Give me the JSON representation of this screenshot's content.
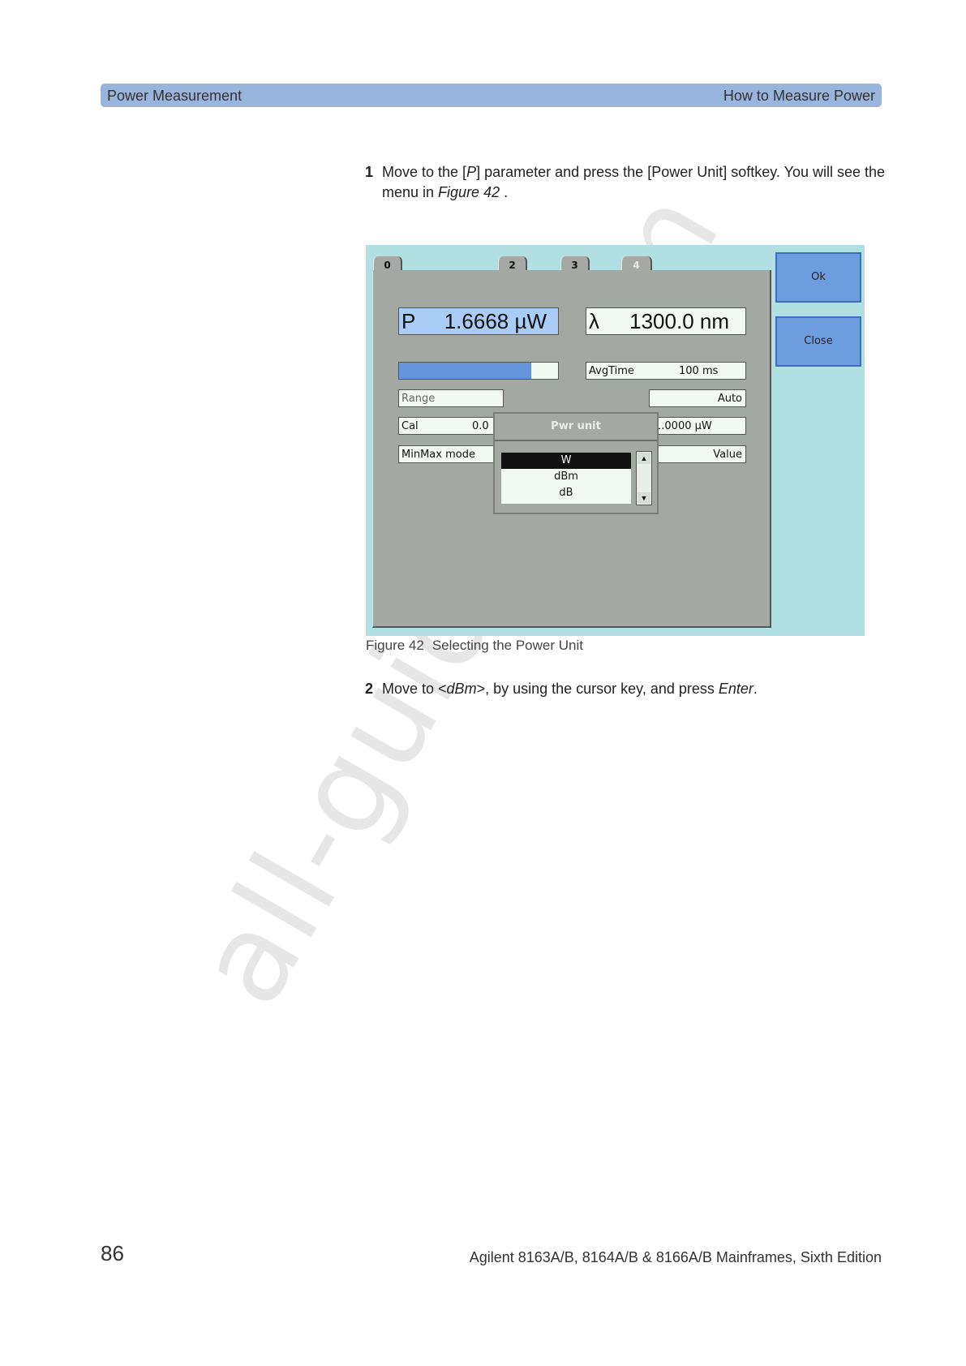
{
  "watermark": "all-guides.com",
  "header": {
    "left": "Power Measurement",
    "right": "How to Measure Power"
  },
  "step1": {
    "num": "1",
    "parts": [
      "Move to the [",
      "P",
      "] parameter and press the [Power Unit] softkey. You will see the menu in ",
      "Figure 42",
      "  ."
    ]
  },
  "figure": {
    "tabs": [
      "0",
      "2",
      "3",
      "4"
    ],
    "power_label": "P",
    "power_value": "1.6668 µW",
    "wavelength_label": "λ",
    "wavelength_value": "1300.0 nm",
    "bar_fill": 0.83,
    "avgtime_label": "AvgTime",
    "avgtime_value": "100  ms",
    "range_label": "Range",
    "range_value": "Auto",
    "cal_label": "Cal",
    "cal_value": "0.0",
    "ref_value": "1.0000  µW",
    "minmax_label": "MinMax mode",
    "minmax_value": "Value",
    "ok_label": "Ok",
    "close_label": "Close",
    "popup_title": "Pwr unit",
    "units": [
      "W",
      "dBm",
      "dB"
    ],
    "selected_unit": "W",
    "colors": {
      "screen_bg": "#b1e0e2",
      "panel": "#a4a8a2",
      "softkey": "#6d9ddf",
      "power_field": "#a9cdf6"
    }
  },
  "caption": {
    "label": "Figure 42",
    "text": "Selecting the Power Unit"
  },
  "step2": {
    "num": "2",
    "parts": [
      "Move to <",
      "dBm",
      ">, by using the cursor key, and press ",
      "Enter",
      "."
    ]
  },
  "footer": {
    "page": "86",
    "title": "Agilent 8163A/B, 8164A/B & 8166A/B Mainframes, Sixth Edition"
  }
}
